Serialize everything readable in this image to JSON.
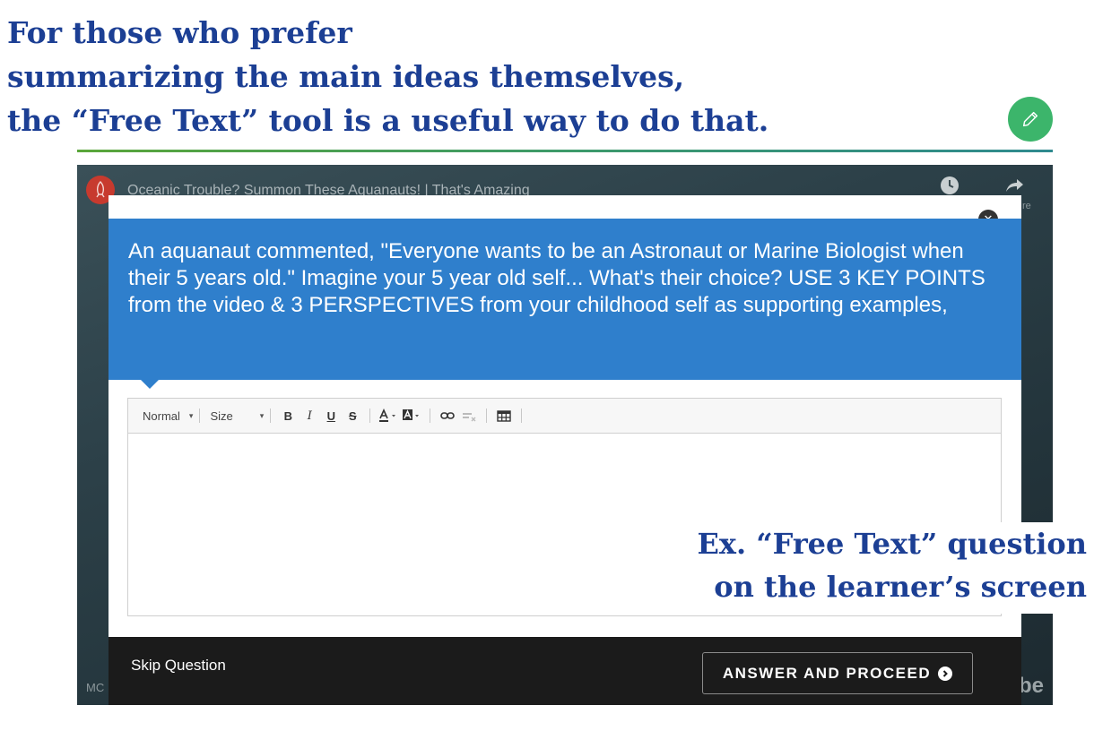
{
  "headline": {
    "line1": "For those  who prefer",
    "line2": "summarizing the main ideas themselves,",
    "line3": "the “Free Text” tool is a useful way to do that."
  },
  "edit_button": {
    "icon": "pencil-icon",
    "color": "#3cb56b"
  },
  "video": {
    "title": "Oceanic Trouble? Summon These Aquanauts! | That's Amazing",
    "corner_left": "MC",
    "edge_text": "re",
    "brand_fragment": "be"
  },
  "question": {
    "prompt": "An aquanaut commented, \"Everyone wants to be an Astronaut or Marine Biologist when their 5 years old.\" Imagine your 5 year old self... What's their choice? USE 3 KEY POINTS from the video & 3 PERSPECTIVES from your childhood self as supporting examples,",
    "color": "#2f7fcc"
  },
  "toolbar": {
    "format_select": "Normal",
    "size_select": "Size",
    "bold": "B",
    "italic": "I",
    "underline": "U",
    "strike": "S"
  },
  "footer": {
    "skip_label": "Skip Question",
    "answer_label": "ANSWER AND PROCEED"
  },
  "callout": {
    "line1": "Ex. “Free Text” question",
    "line2": "on the learner’s screen"
  },
  "colors": {
    "headline": "#1c3f94",
    "divider": "#4aa055"
  }
}
